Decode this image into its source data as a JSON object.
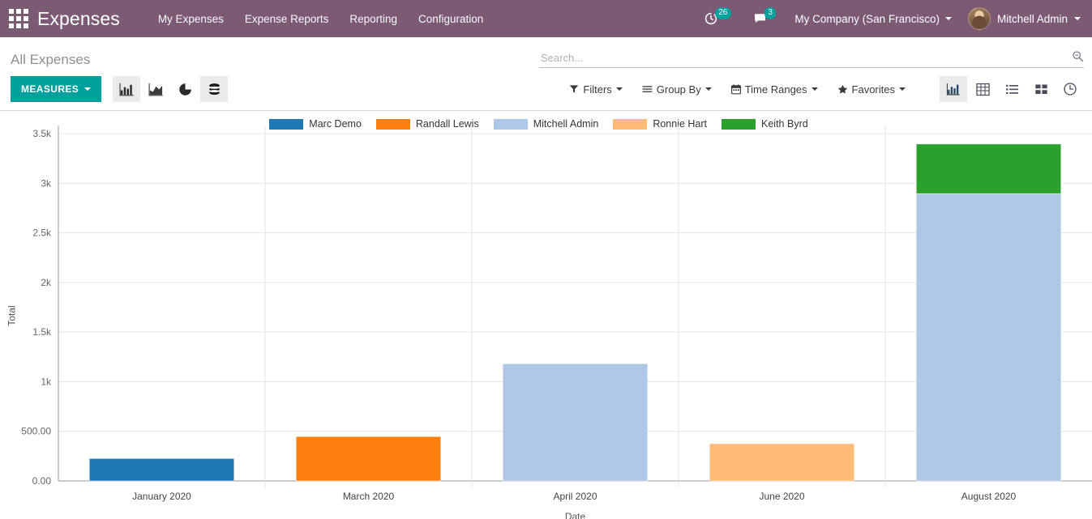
{
  "navbar": {
    "apps_icon": "apps-grid-icon",
    "brand": "Expenses",
    "menu": [
      {
        "label": "My Expenses"
      },
      {
        "label": "Expense Reports"
      },
      {
        "label": "Reporting"
      },
      {
        "label": "Configuration"
      }
    ],
    "activity": {
      "icon": "clock-activity-icon",
      "count": "26"
    },
    "messages": {
      "icon": "chat-bubble-icon",
      "count": "3"
    },
    "company": "My Company (San Francisco)",
    "user": "Mitchell Admin",
    "accent_color": "#7c5a74"
  },
  "control_panel": {
    "breadcrumb": "All Expenses",
    "search": {
      "placeholder": "Search...",
      "value": "",
      "icon": "search-icon"
    },
    "measures_label": "MEASURES",
    "measures_color": "#00a09d",
    "chart_types": [
      {
        "name": "bar-chart-icon",
        "label": "Bar Chart",
        "active": true
      },
      {
        "name": "area-chart-icon",
        "label": "Line Chart",
        "active": false
      },
      {
        "name": "pie-chart-icon",
        "label": "Pie Chart",
        "active": false
      },
      {
        "name": "stacked-icon",
        "label": "Stacked",
        "active": true
      }
    ],
    "filters": [
      {
        "name": "filters",
        "label": "Filters",
        "icon": "filter-funnel-icon"
      },
      {
        "name": "group-by",
        "label": "Group By",
        "icon": "hamburger-lines-icon"
      },
      {
        "name": "time-ranges",
        "label": "Time Ranges",
        "icon": "calendar-icon"
      },
      {
        "name": "favorites",
        "label": "Favorites",
        "icon": "star-icon"
      }
    ],
    "views": [
      {
        "name": "graph-view",
        "icon": "bar-chart-icon",
        "active": true
      },
      {
        "name": "pivot-view",
        "icon": "table-grid-icon",
        "active": false
      },
      {
        "name": "list-view",
        "icon": "list-icon",
        "active": false
      },
      {
        "name": "kanban-view",
        "icon": "kanban-squares-icon",
        "active": false
      },
      {
        "name": "activity-view",
        "icon": "clock-icon",
        "active": false
      }
    ]
  },
  "chart_data": {
    "type": "bar",
    "stacked": true,
    "title": "",
    "xlabel": "Date",
    "ylabel": "Total",
    "categories": [
      "January 2020",
      "March 2020",
      "April 2020",
      "June 2020",
      "August 2020"
    ],
    "ylim": [
      0,
      3500
    ],
    "ytick_values": [
      0,
      500,
      1000,
      1500,
      2000,
      2500,
      3000,
      3500
    ],
    "ytick_labels": [
      "0.00",
      "500.00",
      "1k",
      "1.5k",
      "2k",
      "2.5k",
      "3k",
      "3.5k"
    ],
    "grid": true,
    "legend_position": "top",
    "series": [
      {
        "name": "Marc Demo",
        "color": "#1f77b4",
        "values": [
          226,
          0,
          0,
          0,
          0
        ]
      },
      {
        "name": "Randall Lewis",
        "color": "#ff7f0e",
        "values": [
          0,
          447,
          0,
          0,
          0
        ]
      },
      {
        "name": "Mitchell Admin",
        "color": "#aec7e8",
        "values": [
          0,
          0,
          1180,
          0,
          2895
        ]
      },
      {
        "name": "Ronnie Hart",
        "color": "#ffbb78",
        "values": [
          0,
          0,
          0,
          375,
          0
        ]
      },
      {
        "name": "Keith Byrd",
        "color": "#2ca02c",
        "values": [
          0,
          0,
          0,
          0,
          500
        ]
      }
    ]
  }
}
